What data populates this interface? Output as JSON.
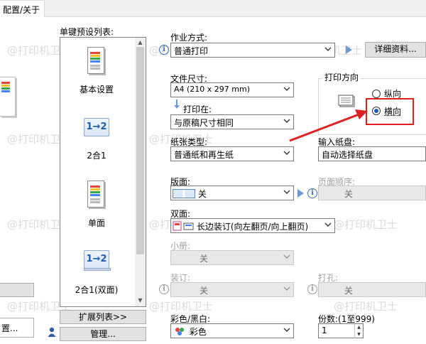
{
  "tab": {
    "label": "配置/关于"
  },
  "left_panel": {
    "cut_button_label": "置..."
  },
  "presets": {
    "title": "单键预设列表:",
    "items": [
      {
        "label": "基本设置",
        "icon": "color-document-icon"
      },
      {
        "label": "2合1",
        "icon": "two-in-one-icon",
        "icon_text": "1→2"
      },
      {
        "label": "单面",
        "icon": "color-document-icon"
      },
      {
        "label": "2合1(双面)",
        "icon": "two-in-one-duplex-icon",
        "icon_text": "1→2"
      }
    ],
    "expand_button": "扩展列表>>",
    "manage_button": "管理..."
  },
  "job_type": {
    "label": "作业方式:",
    "value": "普通打印",
    "details_button": "详细资料..."
  },
  "paper_size": {
    "label": "文件尺寸:",
    "value": "A4 (210 x 297 mm)"
  },
  "print_on": {
    "label": "打印在:",
    "value": "与原稿尺寸相同"
  },
  "paper_type": {
    "label": "纸张类型:",
    "value": "普通纸和再生纸"
  },
  "orientation": {
    "title": "打印方向",
    "portrait": "纵向",
    "landscape": "横向",
    "selected": "landscape"
  },
  "input_tray": {
    "label": "输入纸盘:",
    "value": "自动选择纸盘"
  },
  "layout": {
    "label": "版面:",
    "value": "关"
  },
  "page_order": {
    "label": "页面顺序:",
    "value": "关"
  },
  "duplex": {
    "label": "双面:",
    "value": "长边装订(向左翻页/向上翻页)"
  },
  "booklet": {
    "label": "小册:",
    "value": "关"
  },
  "binding": {
    "label": "装订:",
    "value": "关"
  },
  "punch": {
    "label": "打孔:",
    "value": "关"
  },
  "color_mode": {
    "label": "彩色/黑白:",
    "value": "彩色"
  },
  "copies": {
    "label": "份数:(1至999)",
    "value": "1"
  },
  "watermark_text": "@打印机卫士",
  "colors": {
    "accent": "#1e5bb8",
    "highlight": "#e02020",
    "arrow": "#e02020"
  }
}
